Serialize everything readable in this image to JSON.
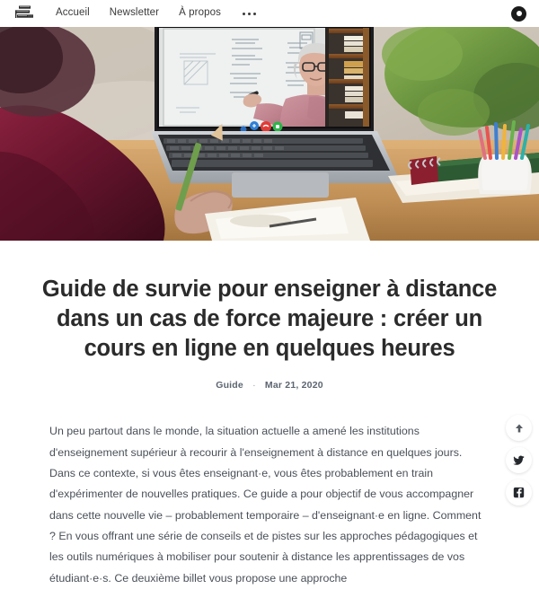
{
  "header": {
    "logo_name": "site-logo",
    "nav": [
      {
        "label": "Accueil"
      },
      {
        "label": "Newsletter"
      },
      {
        "label": "À propos"
      }
    ],
    "more_label": "•••",
    "account_icon": "ring-icon"
  },
  "hero": {
    "alt": "Étudiant·e de dos en pull bordeaux prenant des notes devant un ordinateur portable affichant un appel vidéo avec une enseignante au tableau blanc",
    "video_call_buttons": [
      "share",
      "hangup",
      "mute"
    ],
    "colors": {
      "sweater": "#6e1730",
      "desk": "#c79a63",
      "laptop_body": "#b9bcc0",
      "screen_bezel": "#1d1d20",
      "whiteboard": "#eef0ef",
      "teacher_top": "#c08089",
      "plant": "#6b8f3d",
      "btn_blue": "#2f7fd6",
      "btn_red": "#e23b36",
      "btn_green": "#2fb44a"
    }
  },
  "post": {
    "title": "Guide de survie pour enseigner à distance dans un cas de force majeure : créer un cours en ligne en quelques heures",
    "category": "Guide",
    "separator": "·",
    "date": "Mar 21, 2020",
    "body": "Un peu partout dans le monde, la situation actuelle a amené les institutions d'enseignement supérieur à recourir à l'enseignement à distance en quelques jours. Dans ce contexte, si vous êtes enseignant·e, vous êtes probablement en train d'expérimenter de nouvelles pratiques. Ce guide a pour objectif de vous accompagner dans cette nouvelle vie – probablement temporaire – d'enseignant·e en ligne. Comment ? En vous offrant une série de conseils et de pistes sur les approches pédagogiques et les outils numériques à mobiliser pour soutenir à distance les apprentissages de vos étudiant·e·s. Ce deuxième billet vous propose une approche"
  },
  "share_rail": {
    "items": [
      {
        "icon": "arrow-up-icon",
        "label": "Haut de page"
      },
      {
        "icon": "twitter-icon",
        "label": "Twitter"
      },
      {
        "icon": "facebook-icon",
        "label": "Facebook"
      }
    ]
  },
  "colors": {
    "text": "#4a5058",
    "heading": "#2b2b2b",
    "meta": "#5c6570",
    "background": "#ffffff"
  }
}
